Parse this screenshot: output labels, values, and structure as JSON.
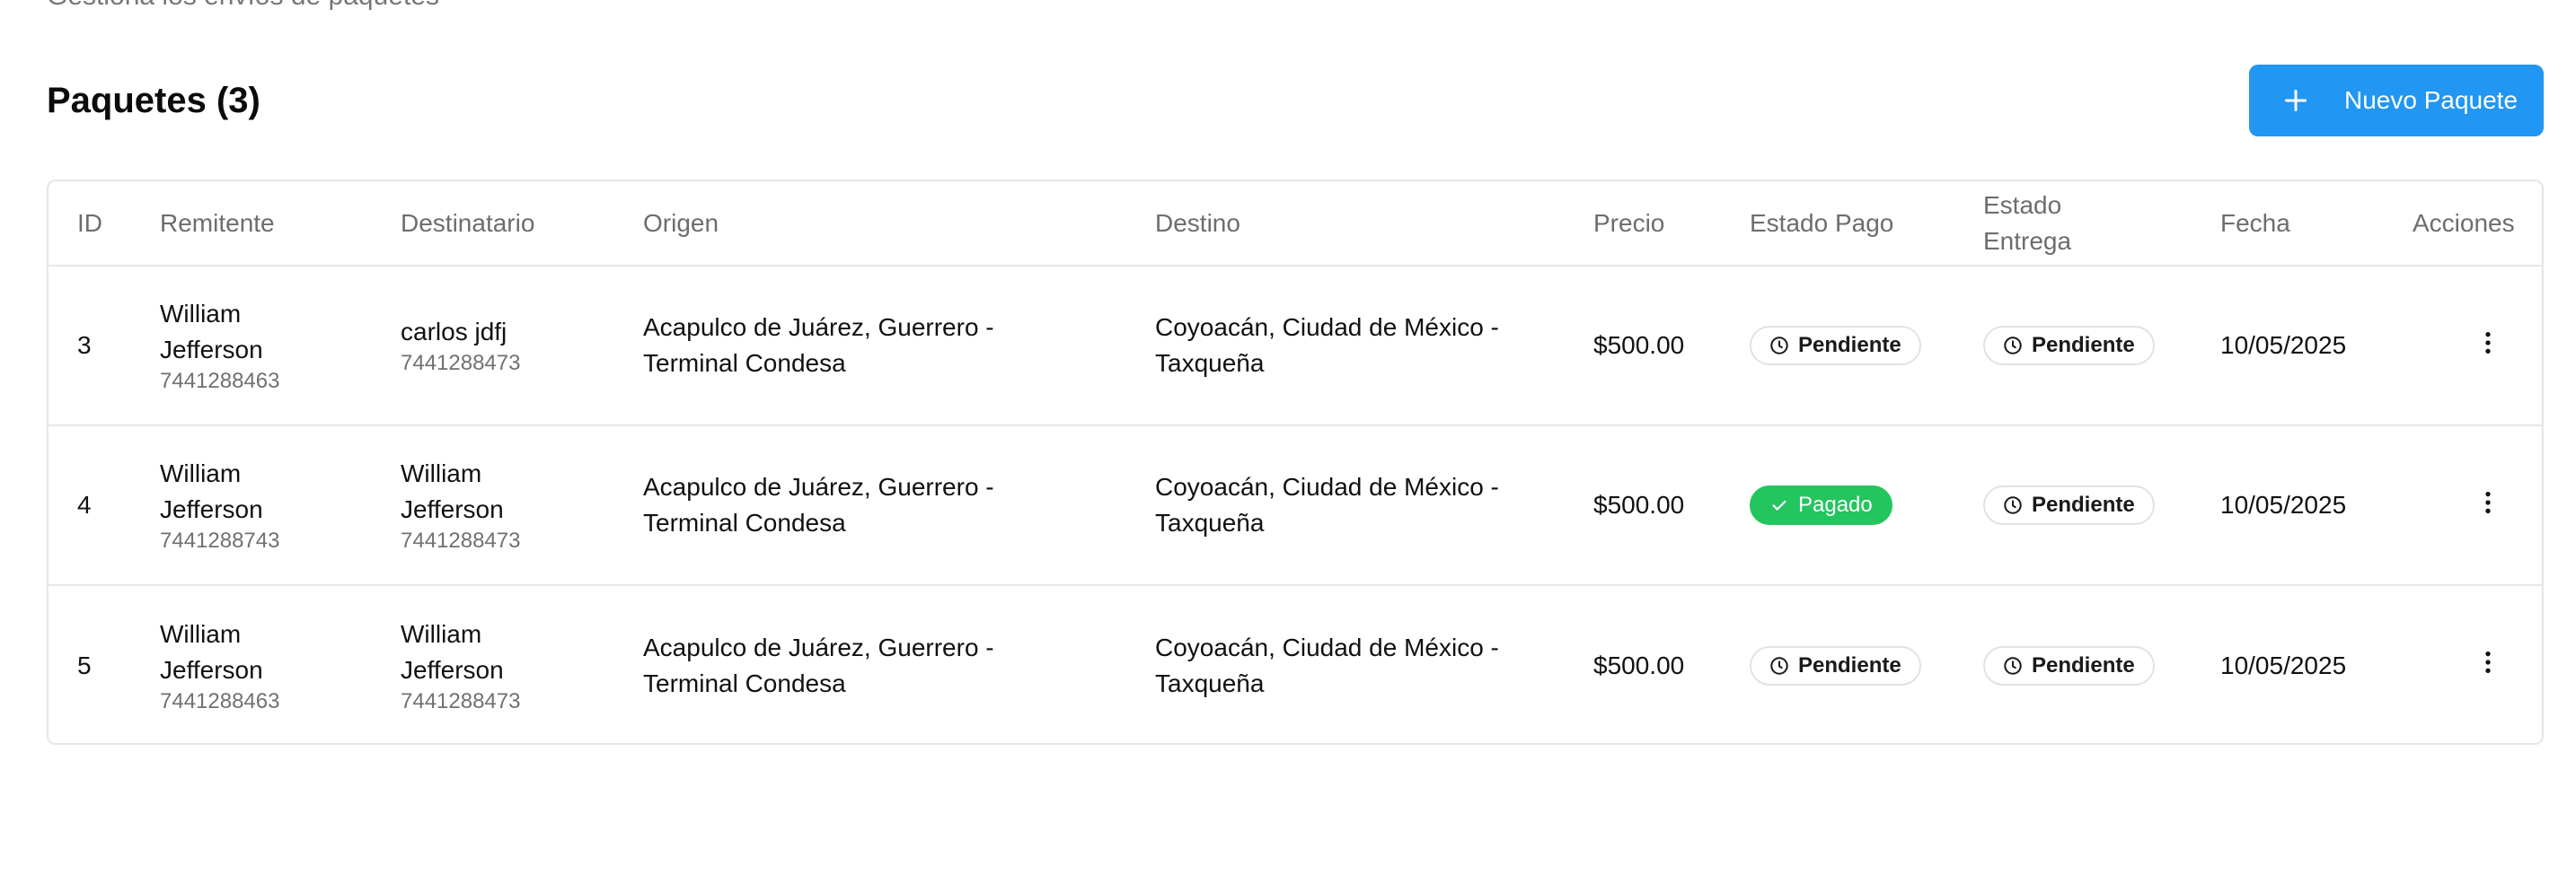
{
  "header": {
    "subtitle": "Gestiona los envíos de paquetes",
    "section_title": "Paquetes (3)",
    "new_button_label": "Nuevo Paquete"
  },
  "colors": {
    "accent": "#2196f3",
    "paid": "#22c55e",
    "border": "#e6e6e6",
    "muted_text": "#6d6d6d"
  },
  "table": {
    "columns": {
      "id": "ID",
      "sender": "Remitente",
      "recipient": "Destinatario",
      "origin": "Origen",
      "destination": "Destino",
      "price": "Precio",
      "payment_status": "Estado Pago",
      "delivery_status_line1": "Estado",
      "delivery_status_line2": "Entrega",
      "date": "Fecha",
      "actions": "Acciones"
    },
    "rows": [
      {
        "id": "3",
        "sender_name_1": "William",
        "sender_name_2": "Jefferson",
        "sender_phone": "7441288463",
        "recipient_name_1": "carlos jdfj",
        "recipient_name_2": "",
        "recipient_phone": "7441288473",
        "origin_1": "Acapulco de Juárez, Guerrero -",
        "origin_2": "Terminal Condesa",
        "destination_1": "Coyoacán, Ciudad de México -",
        "destination_2": "Taxqueña",
        "price": "$500.00",
        "payment_status": "Pendiente",
        "payment_icon": "clock-icon",
        "delivery_status": "Pendiente",
        "delivery_icon": "clock-icon",
        "date": "10/05/2025",
        "actions_icon": "more-vertical-icon"
      },
      {
        "id": "4",
        "sender_name_1": "William",
        "sender_name_2": "Jefferson",
        "sender_phone": "7441288743",
        "recipient_name_1": "William",
        "recipient_name_2": "Jefferson",
        "recipient_phone": "7441288473",
        "origin_1": "Acapulco de Juárez, Guerrero -",
        "origin_2": "Terminal Condesa",
        "destination_1": "Coyoacán, Ciudad de México -",
        "destination_2": "Taxqueña",
        "price": "$500.00",
        "payment_status": "Pagado",
        "payment_icon": "check-icon",
        "delivery_status": "Pendiente",
        "delivery_icon": "clock-icon",
        "date": "10/05/2025",
        "actions_icon": "more-vertical-icon"
      },
      {
        "id": "5",
        "sender_name_1": "William",
        "sender_name_2": "Jefferson",
        "sender_phone": "7441288463",
        "recipient_name_1": "William",
        "recipient_name_2": "Jefferson",
        "recipient_phone": "7441288473",
        "origin_1": "Acapulco de Juárez, Guerrero -",
        "origin_2": "Terminal Condesa",
        "destination_1": "Coyoacán, Ciudad de México -",
        "destination_2": "Taxqueña",
        "price": "$500.00",
        "payment_status": "Pendiente",
        "payment_icon": "clock-icon",
        "delivery_status": "Pendiente",
        "delivery_icon": "clock-icon",
        "date": "10/05/2025",
        "actions_icon": "more-vertical-icon"
      }
    ]
  }
}
